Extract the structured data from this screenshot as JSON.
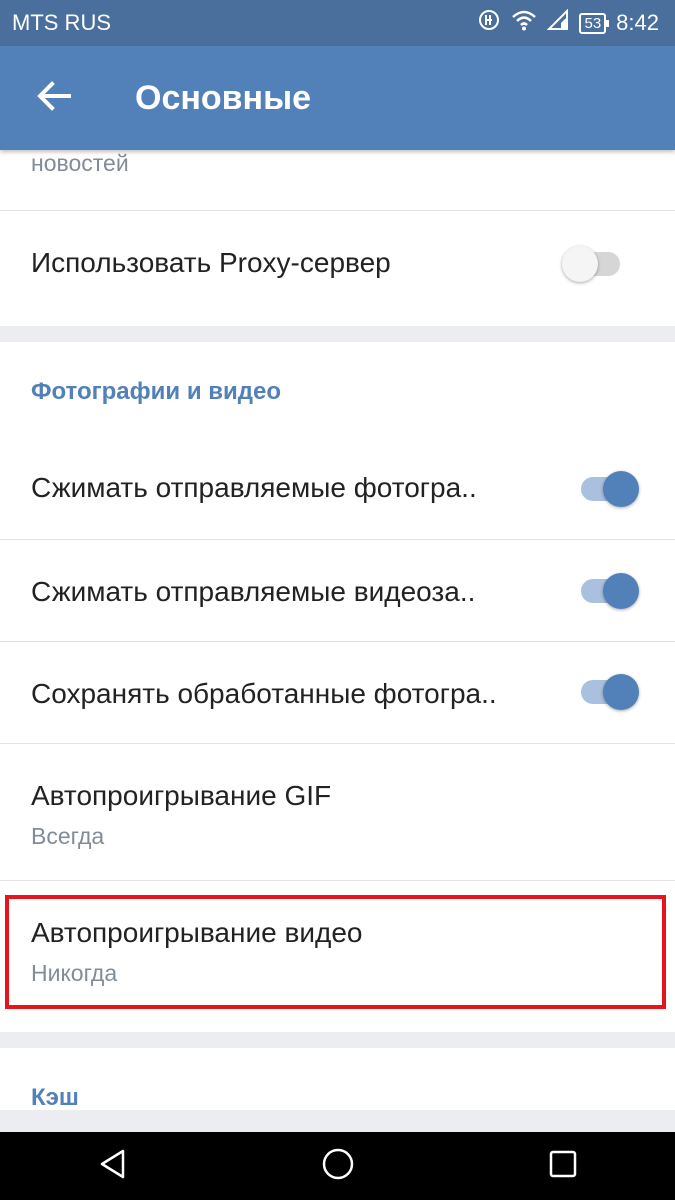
{
  "status_bar": {
    "carrier": "MTS RUS",
    "battery": "53",
    "time": "8:42"
  },
  "app_bar": {
    "title": "Основные"
  },
  "top_card": {
    "cut_text": "новостей",
    "proxy_label": "Использовать Proxy-сервер",
    "proxy_enabled": false
  },
  "photos_section": {
    "title": "Фотографии и видео",
    "items": [
      {
        "label": "Сжимать отправляемые фотогра..",
        "enabled": true
      },
      {
        "label": "Сжимать отправляемые видеоза..",
        "enabled": true
      },
      {
        "label": "Сохранять обработанные фотогра..",
        "enabled": true
      }
    ],
    "gif": {
      "label": "Автопроигрывание GIF",
      "value": "Всегда"
    },
    "video": {
      "label": "Автопроигрывание видео",
      "value": "Никогда"
    }
  },
  "cache_section": {
    "title": "Кэш"
  },
  "colors": {
    "accent": "#5181b8",
    "status_bar": "#4a6f9c",
    "highlight": "#e8141b"
  }
}
